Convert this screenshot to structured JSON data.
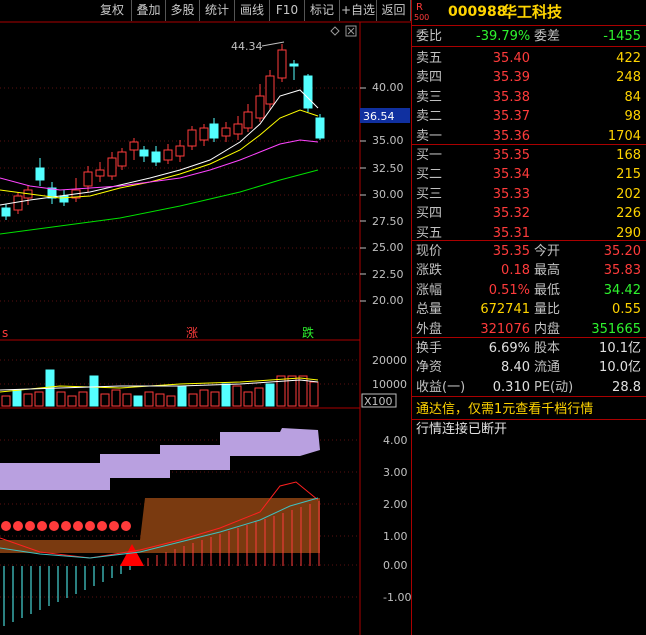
{
  "toolbar": {
    "items": [
      "复权",
      "叠加",
      "多股",
      "统计",
      "画线",
      "F10",
      "标记",
      "+自选",
      "返回"
    ]
  },
  "main_chart": {
    "high_label": "44.34",
    "price_axis": [
      "40.00",
      "35.00",
      "32.50",
      "30.00",
      "27.50",
      "25.00",
      "22.50",
      "20.00"
    ],
    "current_price_tag": "36.54",
    "markers": {
      "left": "s",
      "mid": "涨",
      "right": "跌"
    }
  },
  "volume_chart": {
    "axis": [
      "20000",
      "10000"
    ],
    "unit_tag": "X100"
  },
  "indicator_chart": {
    "axis": [
      "4.00",
      "3.00",
      "2.00",
      "1.00",
      "0.00",
      "-1.00"
    ]
  },
  "quote": {
    "r_badge": "R",
    "r_sub": "500",
    "code": "000988",
    "name": "华工科技",
    "weibi_label": "委比",
    "weibi_value": "-39.79%",
    "weicha_label": "委差",
    "weicha_value": "-1455",
    "sell": [
      {
        "label": "卖五",
        "price": "35.40",
        "vol": "422"
      },
      {
        "label": "卖四",
        "price": "35.39",
        "vol": "248"
      },
      {
        "label": "卖三",
        "price": "35.38",
        "vol": "84"
      },
      {
        "label": "卖二",
        "price": "35.37",
        "vol": "98"
      },
      {
        "label": "卖一",
        "price": "35.36",
        "vol": "1704"
      }
    ],
    "buy": [
      {
        "label": "买一",
        "price": "35.35",
        "vol": "168"
      },
      {
        "label": "买二",
        "price": "35.34",
        "vol": "215"
      },
      {
        "label": "买三",
        "price": "35.33",
        "vol": "202"
      },
      {
        "label": "买四",
        "price": "35.32",
        "vol": "226"
      },
      {
        "label": "买五",
        "price": "35.31",
        "vol": "290"
      }
    ],
    "stats": [
      {
        "l1": "现价",
        "v1": "35.35",
        "l2": "今开",
        "v2": "35.20"
      },
      {
        "l1": "涨跌",
        "v1": "0.18",
        "l2": "最高",
        "v2": "35.83"
      },
      {
        "l1": "涨幅",
        "v1": "0.51%",
        "l2": "最低",
        "v2": "34.42"
      },
      {
        "l1": "总量",
        "v1": "672741",
        "l2": "量比",
        "v2": "0.55"
      },
      {
        "l1": "外盘",
        "v1": "321076",
        "l2": "内盘",
        "v2": "351665"
      }
    ],
    "stats2": [
      {
        "l1": "换手",
        "v1": "6.69%",
        "l2": "股本",
        "v2": "10.1亿"
      },
      {
        "l1": "净资",
        "v1": "8.40",
        "l2": "流通",
        "v2": "10.0亿"
      },
      {
        "l1": "收益(一)",
        "v1": "0.310",
        "l2": "PE(动)",
        "v2": "28.8"
      }
    ],
    "notice": "通达信，仅需1元查看千档行情",
    "status": "行情连接已断开"
  },
  "colors": {
    "up": "#ff3b3b",
    "down": "#54ffff",
    "border": "#aa0000",
    "ma5": "#ffffff",
    "ma10": "#ffff00",
    "ma20": "#ff44ff",
    "ma60": "#00e000",
    "cloud": "#b9a0e0",
    "band": "#7a3a10"
  }
}
